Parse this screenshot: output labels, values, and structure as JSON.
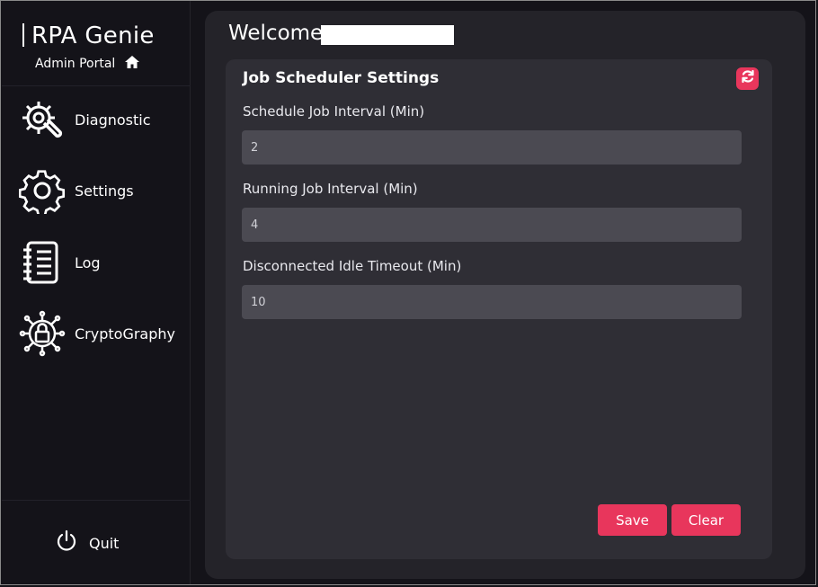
{
  "sidebar": {
    "title": "RPA Genie",
    "subtitle": "Admin Portal",
    "items": [
      {
        "label": "Diagnostic",
        "icon": "diagnostic-gear-wrench-icon"
      },
      {
        "label": "Settings",
        "icon": "gear-icon"
      },
      {
        "label": "Log",
        "icon": "log-notebook-icon"
      },
      {
        "label": "CryptoGraphy",
        "icon": "lock-circuit-icon"
      }
    ],
    "quit_label": "Quit"
  },
  "header": {
    "welcome": "Welcome"
  },
  "card": {
    "title": "Job Scheduler Settings",
    "fields": [
      {
        "label": "Schedule Job Interval (Min)",
        "value": "2"
      },
      {
        "label": "Running Job Interval (Min)",
        "value": "4"
      },
      {
        "label": "Disconnected Idle Timeout (Min)",
        "value": "10"
      }
    ],
    "save_label": "Save",
    "clear_label": "Clear"
  },
  "colors": {
    "accent": "#e8365c",
    "background": "#141319",
    "panel": "#242329",
    "card": "#2f2e35",
    "input": "#4b4a52"
  }
}
